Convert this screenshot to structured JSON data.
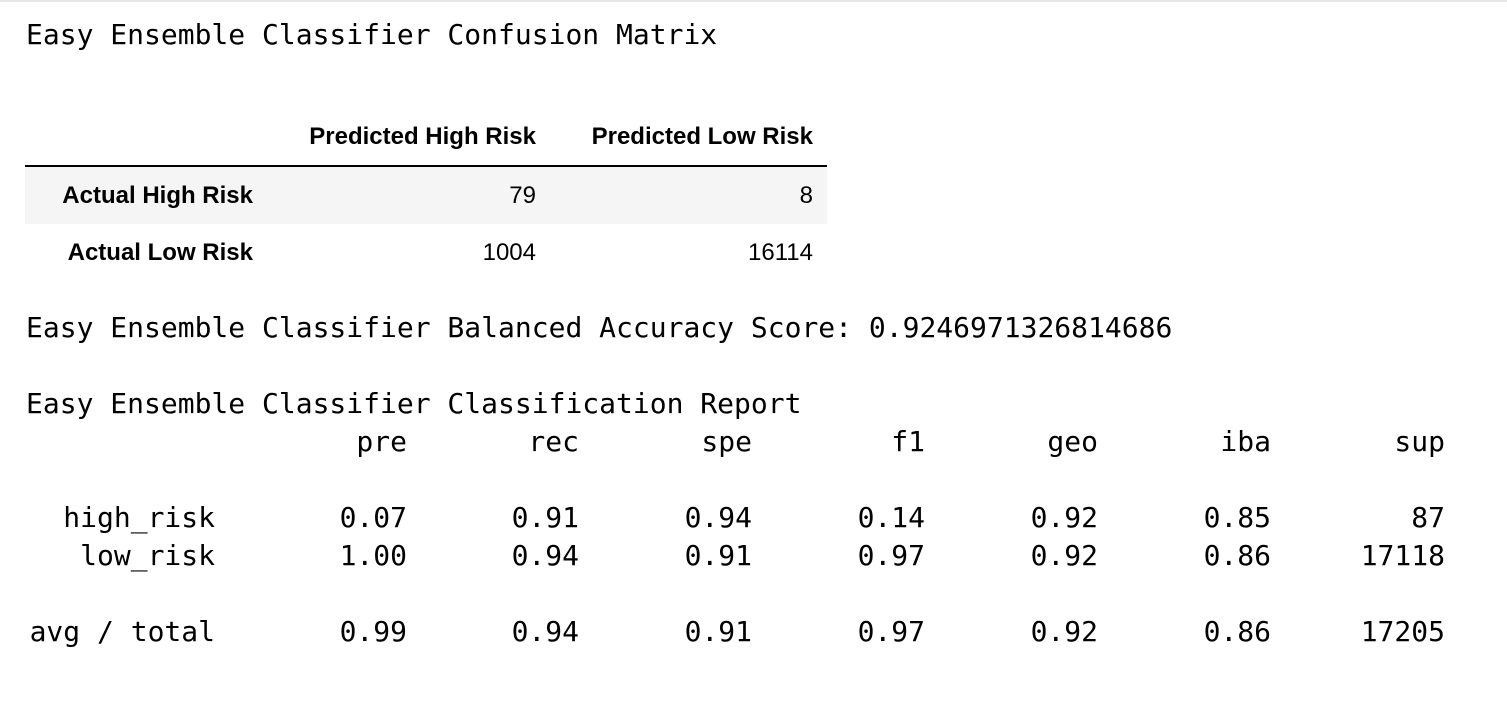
{
  "confusion_matrix": {
    "title": "Easy Ensemble Classifier Confusion Matrix",
    "columns": [
      "Predicted High Risk",
      "Predicted Low Risk"
    ],
    "rows": [
      {
        "label": "Actual High Risk",
        "values": [
          "79",
          "8"
        ]
      },
      {
        "label": "Actual Low Risk",
        "values": [
          "1004",
          "16114"
        ]
      }
    ]
  },
  "balanced_accuracy": {
    "label": "Easy Ensemble Classifier Balanced Accuracy Score:",
    "value": "0.9246971326814686"
  },
  "classification_report": {
    "title": "Easy Ensemble Classifier Classification Report",
    "columns": [
      "pre",
      "rec",
      "spe",
      "f1",
      "geo",
      "iba",
      "sup"
    ],
    "rows": [
      {
        "label": "high_risk",
        "values": [
          "0.07",
          "0.91",
          "0.94",
          "0.14",
          "0.92",
          "0.85",
          "87"
        ]
      },
      {
        "label": "low_risk",
        "values": [
          "1.00",
          "0.94",
          "0.91",
          "0.97",
          "0.92",
          "0.86",
          "17118"
        ]
      }
    ],
    "total": {
      "label": "avg / total",
      "values": [
        "0.99",
        "0.94",
        "0.91",
        "0.97",
        "0.92",
        "0.86",
        "17205"
      ]
    }
  }
}
